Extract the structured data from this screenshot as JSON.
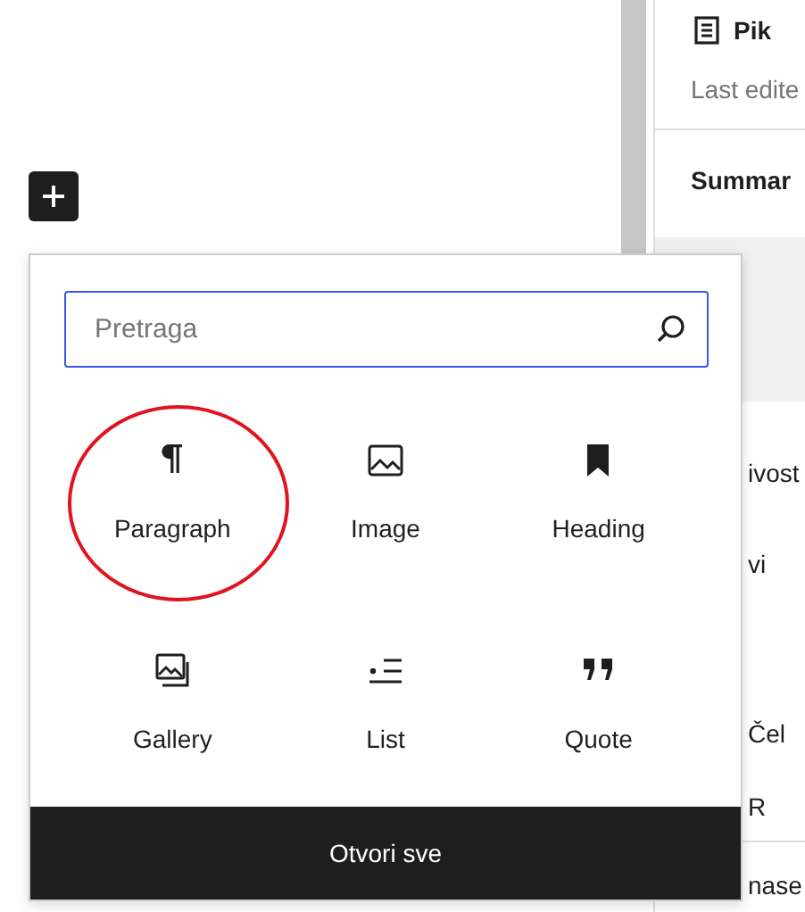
{
  "sidebar": {
    "title": "Pik",
    "subtitle": "Last edite",
    "section": "Summar",
    "fragments": [
      "ivost",
      "vi",
      "Čel",
      "R",
      "nase"
    ]
  },
  "inserter": {
    "search": {
      "placeholder": "Pretraga"
    },
    "blocks": [
      {
        "kind": "paragraph",
        "label": "Paragraph",
        "circled": true
      },
      {
        "kind": "image",
        "label": "Image",
        "circled": false
      },
      {
        "kind": "heading",
        "label": "Heading",
        "circled": false
      },
      {
        "kind": "gallery",
        "label": "Gallery",
        "circled": false
      },
      {
        "kind": "list",
        "label": "List",
        "circled": false
      },
      {
        "kind": "quote",
        "label": "Quote",
        "circled": false
      }
    ],
    "footer_button": "Otvori sve"
  }
}
